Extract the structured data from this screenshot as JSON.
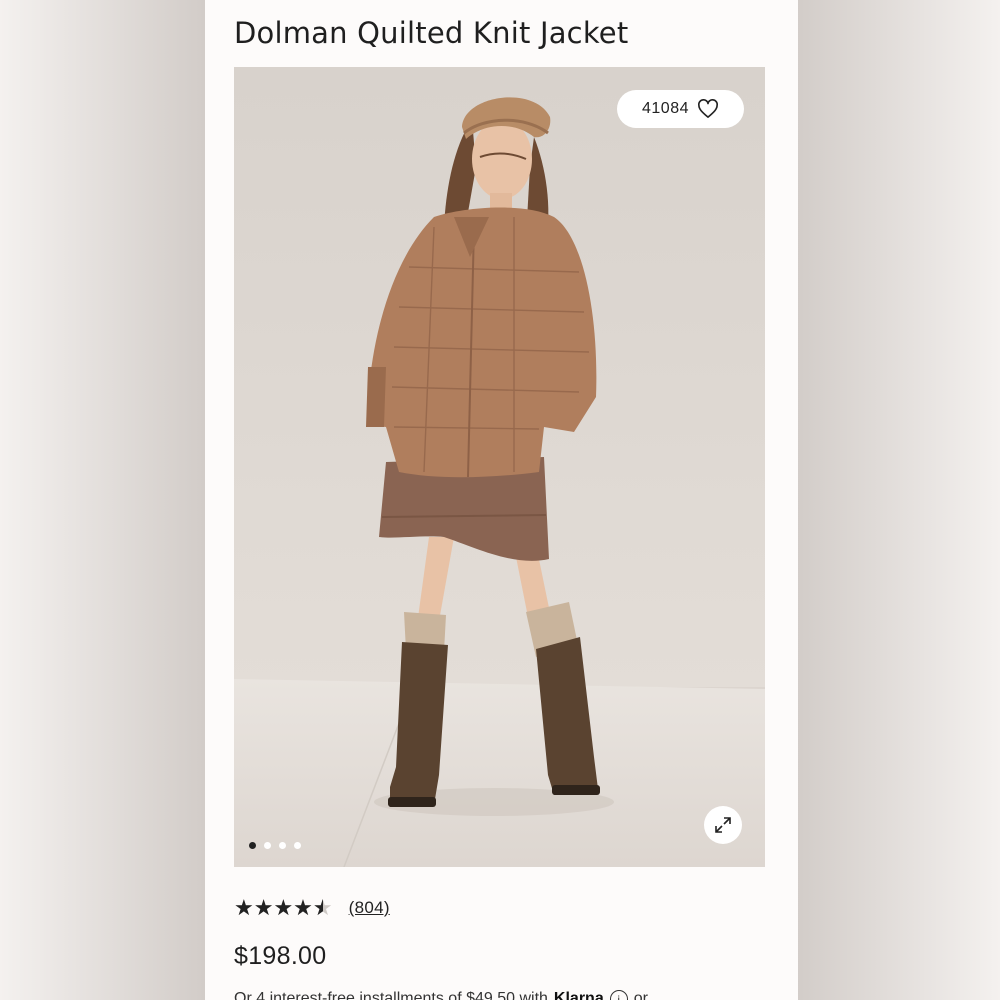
{
  "product": {
    "title": "Dolman Quilted Knit Jacket",
    "favorites_count": "41084",
    "image_count": 4,
    "active_image_index": 0,
    "rating": 4.5,
    "rating_max": 5,
    "review_count": "(804)",
    "price": "$198.00",
    "installments_text": "Or 4 interest-free installments of $49.50 with",
    "installments_provider": "Klarna",
    "installments_suffix": "or"
  },
  "icons": {
    "favorite": "heart-icon",
    "expand": "expand-arrows-icon",
    "info": "info-icon"
  },
  "colors": {
    "page_background": "#fdfbfa",
    "text": "#1f1f1f",
    "photo_backdrop": "#dcd5cf",
    "jacket": "#b07e5d",
    "skirt": "#8a6452",
    "boots": "#5a4330"
  }
}
